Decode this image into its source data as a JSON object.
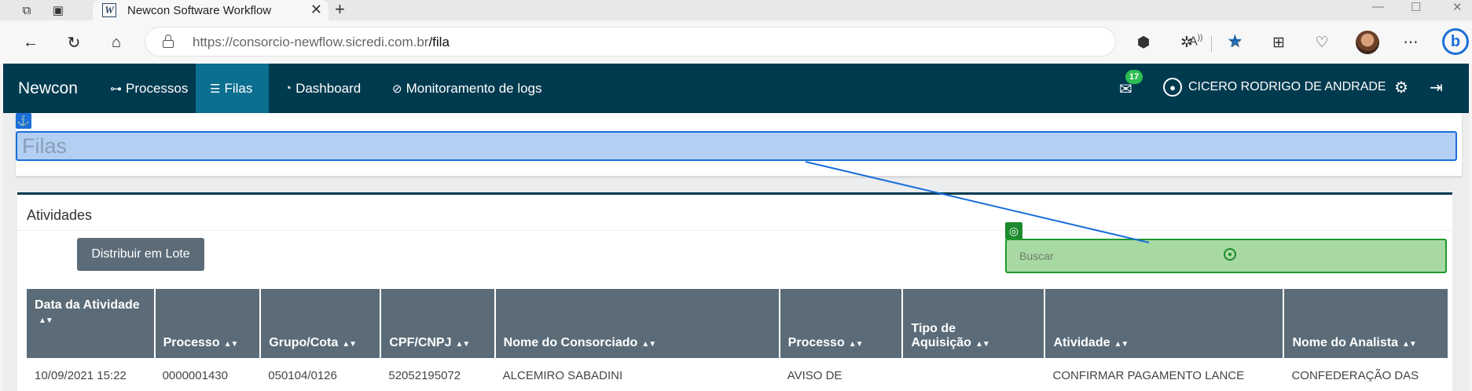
{
  "browser": {
    "tab_title": "Newcon Software Workflow",
    "url_host": "https://consorcio-newflow.sicredi.com.br",
    "url_path": "/fila",
    "favicon_letter": "W"
  },
  "app": {
    "brand": "Newcon",
    "nav": [
      {
        "label": "Processos",
        "icon": "sitemap-icon"
      },
      {
        "label": "Filas",
        "icon": "list-icon"
      },
      {
        "label": "Dashboard",
        "icon": "dashboard-icon"
      },
      {
        "label": "Monitoramento de logs",
        "icon": "compass-icon"
      }
    ],
    "notification_count": "17",
    "user_name": "CICERO RODRIGO DE ANDRADE"
  },
  "page": {
    "title": "Filas",
    "section_title": "Atividades",
    "batch_button": "Distribuir em Lote",
    "search_placeholder": "Buscar"
  },
  "table": {
    "headers": [
      "Data da Atividade",
      "Processo",
      "Grupo/Cota",
      "CPF/CNPJ",
      "Nome do Consorciado",
      "Processo",
      "Tipo de Aquisição",
      "Atividade",
      "Nome do Analista"
    ],
    "rows": [
      [
        "10/09/2021 15:22",
        "0000001430",
        "050104/0126",
        "52052195072",
        "ALCEMIRO SABADINI",
        "AVISO DE",
        "",
        "CONFIRMAR PAGAMENTO LANCE",
        "CONFEDERAÇÃO DAS"
      ]
    ]
  },
  "colors": {
    "navbar": "#003a4f",
    "navbar_active": "#0b6f8f",
    "header_gray": "#5b6c78",
    "highlight_blue": "#b3cff4",
    "highlight_green": "#a9d9a2"
  }
}
